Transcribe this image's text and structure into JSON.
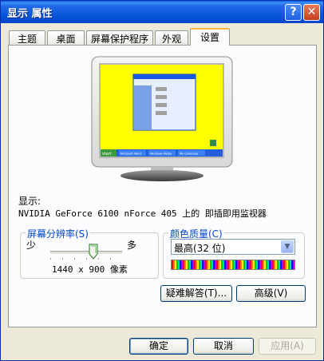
{
  "window": {
    "title": "显示 属性"
  },
  "tabs": [
    {
      "label": "主题"
    },
    {
      "label": "桌面"
    },
    {
      "label": "屏幕保护程序"
    },
    {
      "label": "外观"
    },
    {
      "label": "设置"
    }
  ],
  "preview": {
    "desktop_color": "#ffff00",
    "start_label": "start",
    "taskbar_items": [
      "Microsoft Word",
      "Windows Media",
      "My Computer"
    ]
  },
  "display": {
    "label": "显示:",
    "device": "NVIDIA GeForce 6100 nForce 405 上的 即插即用监视器"
  },
  "resolution": {
    "group_title": "屏幕分辨率(S)",
    "less": "少",
    "more": "多",
    "value": "1440 x 900 像素",
    "slider_level": 0.6
  },
  "color_quality": {
    "group_title": "颜色质量(C)",
    "selected": "最高(32 位)"
  },
  "buttons": {
    "troubleshoot": "疑难解答(T)...",
    "advanced": "高级(V)",
    "ok": "确定",
    "cancel": "取消",
    "apply": "应用(A)"
  },
  "colors": {
    "accent": "#0046d5",
    "titlebar": "#0553d8",
    "tab_highlight": "#f8b63a"
  }
}
